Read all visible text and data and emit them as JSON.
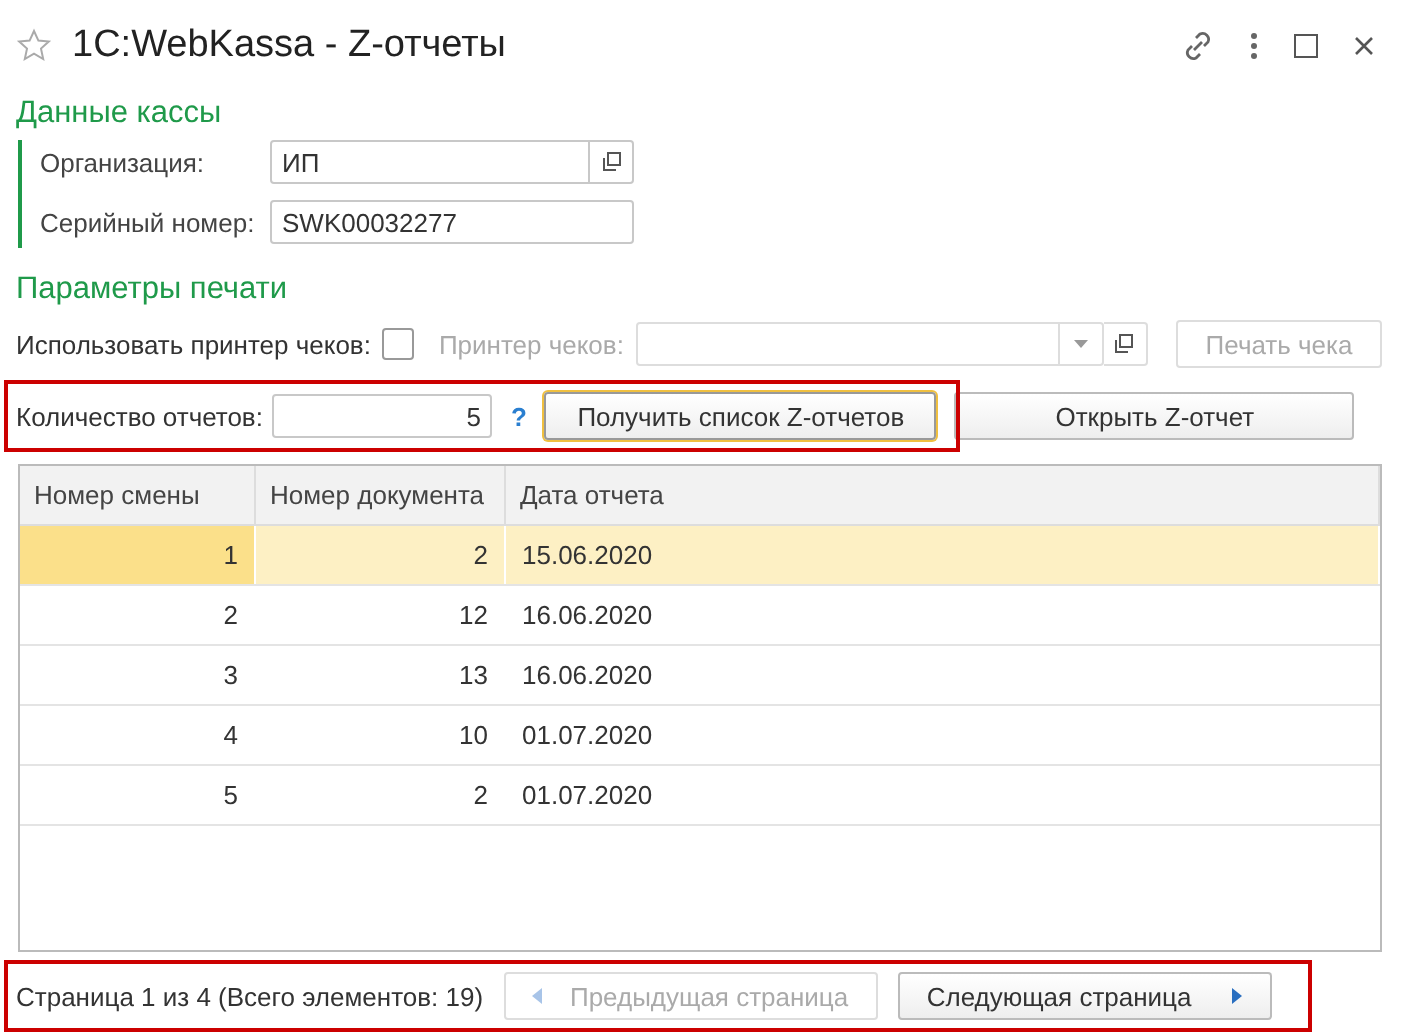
{
  "window": {
    "title": "1C:WebKassa - Z-отчеты",
    "favorite": false
  },
  "cash_register": {
    "heading": "Данные кассы",
    "fields": [
      {
        "label": "Организация:",
        "value": "ИП",
        "has_open_button": true
      },
      {
        "label": "Серийный номер:",
        "value": "SWK00032277",
        "has_open_button": false
      }
    ]
  },
  "print_params": {
    "heading": "Параметры печати",
    "use_printer_label": "Использовать принтер чеков:",
    "use_printer_checked": false,
    "printer_label": "Принтер чеков:",
    "printer_disabled": true,
    "print_button": {
      "label": "Печать чека",
      "disabled": true
    }
  },
  "report_count": {
    "label": "Количество отчетов:",
    "value": "5",
    "help": "?"
  },
  "get_list_button": {
    "label": "Получить список Z-отчетов",
    "default": true
  },
  "open_report_button": {
    "label": "Открыть Z-отчет",
    "default": false
  },
  "table": {
    "columns": [
      "Номер смены",
      "Номер документа",
      "Дата отчета"
    ],
    "rows": [
      {
        "cells": [
          "1",
          "2",
          "15.06.2020"
        ],
        "selected": true
      },
      {
        "cells": [
          "2",
          "12",
          "16.06.2020"
        ],
        "selected": false
      },
      {
        "cells": [
          "3",
          "13",
          "16.06.2020"
        ],
        "selected": false
      },
      {
        "cells": [
          "4",
          "10",
          "01.07.2020"
        ],
        "selected": false
      },
      {
        "cells": [
          "5",
          "2",
          "01.07.2020"
        ],
        "selected": false
      }
    ]
  },
  "pager": {
    "status": "Страница 1 из 4 (Всего элементов: 19)",
    "prev": {
      "label": "Предыдущая страница",
      "disabled": true
    },
    "next": {
      "label": "Следующая страница",
      "disabled": false
    }
  }
}
